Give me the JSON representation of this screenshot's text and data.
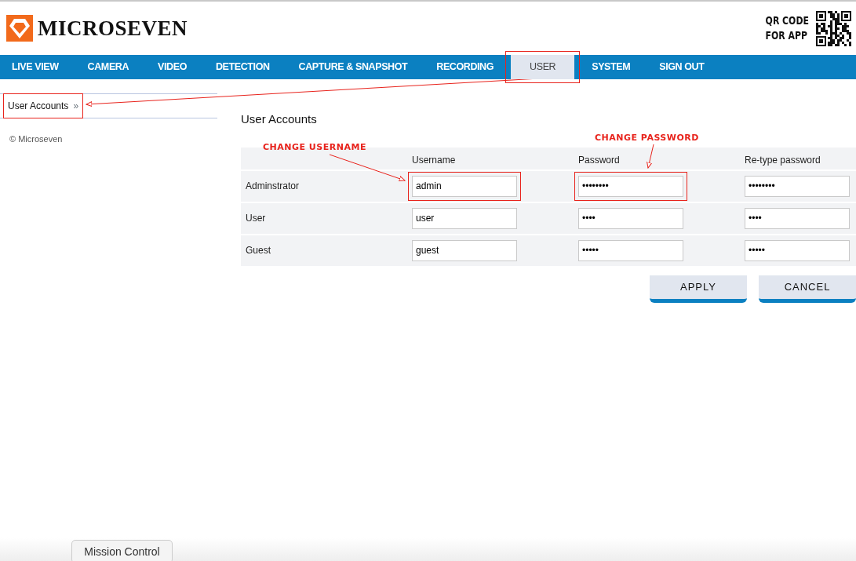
{
  "brand": {
    "name": "MICROSEVEN",
    "qr_label_lines": [
      "QR CODE",
      "FOR APP"
    ]
  },
  "nav": [
    {
      "label": "LIVE VIEW",
      "selected": false,
      "highlighted": false
    },
    {
      "label": "CAMERA",
      "selected": false,
      "highlighted": false
    },
    {
      "label": "VIDEO",
      "selected": false,
      "highlighted": false
    },
    {
      "label": "DETECTION",
      "selected": false,
      "highlighted": false
    },
    {
      "label": "CAPTURE & SNAPSHOT",
      "selected": false,
      "highlighted": false
    },
    {
      "label": "RECORDING",
      "selected": false,
      "highlighted": false
    },
    {
      "label": "USER",
      "selected": true,
      "highlighted": true
    },
    {
      "label": "SYSTEM",
      "selected": false,
      "highlighted": false
    },
    {
      "label": "SIGN OUT",
      "selected": false,
      "highlighted": false
    }
  ],
  "sidebar": {
    "items": [
      {
        "label": "User Accounts",
        "marker": "»",
        "highlighted": true
      }
    ],
    "footer": "© Microseven"
  },
  "page_title": "User Accounts",
  "table": {
    "columns": [
      "Username",
      "Password",
      "Re-type password"
    ],
    "rows": [
      {
        "label": "Adminstrator",
        "fields": [
          {
            "value": "admin",
            "highlighted": true
          },
          {
            "value": "••••••••",
            "highlighted": true
          },
          {
            "value": "••••••••",
            "highlighted": false
          }
        ]
      },
      {
        "label": "User",
        "fields": [
          {
            "value": "user",
            "highlighted": false
          },
          {
            "value": "••••",
            "highlighted": false
          },
          {
            "value": "••••",
            "highlighted": false
          }
        ]
      },
      {
        "label": "Guest",
        "fields": [
          {
            "value": "guest",
            "highlighted": false
          },
          {
            "value": "•••••",
            "highlighted": false
          },
          {
            "value": "•••••",
            "highlighted": false
          }
        ]
      }
    ]
  },
  "buttons": [
    "APPLY",
    "CANCEL"
  ],
  "annotations": [
    "CHANGE USERNAME",
    "CHANGE PASSWORD"
  ],
  "dock_button": "Mission Control"
}
